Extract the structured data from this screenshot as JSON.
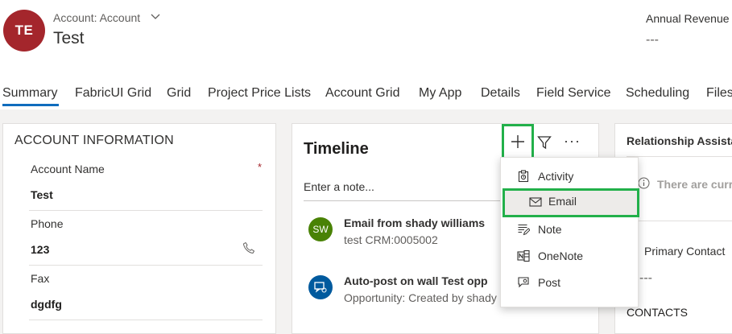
{
  "header": {
    "avatar_initials": "TE",
    "entity_type": "Account: Account",
    "record_name": "Test",
    "annual_revenue_label": "Annual Revenue",
    "annual_revenue_value": "---"
  },
  "tabs": [
    {
      "label": "Summary",
      "active": true
    },
    {
      "label": "FabricUI Grid"
    },
    {
      "label": "Grid"
    },
    {
      "label": "Project Price Lists"
    },
    {
      "label": "Account Grid"
    },
    {
      "label": "My App"
    },
    {
      "label": "Details"
    },
    {
      "label": "Field Service"
    },
    {
      "label": "Scheduling"
    },
    {
      "label": "Files"
    }
  ],
  "account_info": {
    "section_title": "ACCOUNT INFORMATION",
    "required_marker": "*",
    "fields": [
      {
        "label": "Account Name",
        "value": "Test"
      },
      {
        "label": "Phone",
        "value": "123"
      },
      {
        "label": "Fax",
        "value": "dgdfg"
      }
    ]
  },
  "timeline": {
    "title": "Timeline",
    "more_label": "···",
    "note_placeholder": "Enter a note...",
    "items": [
      {
        "avatar": "SW",
        "title": "Email from shady williams",
        "subtitle": "test CRM:0005002"
      },
      {
        "title": "Auto-post on wall Test opp",
        "subtitle": "Opportunity: Created by shady"
      }
    ]
  },
  "add_menu": {
    "items": [
      {
        "label": "Activity",
        "icon": "activity-icon"
      },
      {
        "label": "Email",
        "icon": "email-icon",
        "highlighted": true
      },
      {
        "label": "Note",
        "icon": "note-icon"
      },
      {
        "label": "OneNote",
        "icon": "onenote-icon"
      },
      {
        "label": "Post",
        "icon": "post-icon"
      }
    ]
  },
  "relationship_assistant": {
    "title": "Relationship Assistant",
    "empty_text": "There are curre",
    "primary_contact_label": "Primary Contact",
    "primary_contact_value": "---",
    "contacts_label": "CONTACTS"
  },
  "colors": {
    "avatar": "#a4262c",
    "accent": "#0f6cbd",
    "highlight_border": "#22b04a",
    "sw_avatar": "#498205",
    "post_avatar": "#005a9e"
  }
}
